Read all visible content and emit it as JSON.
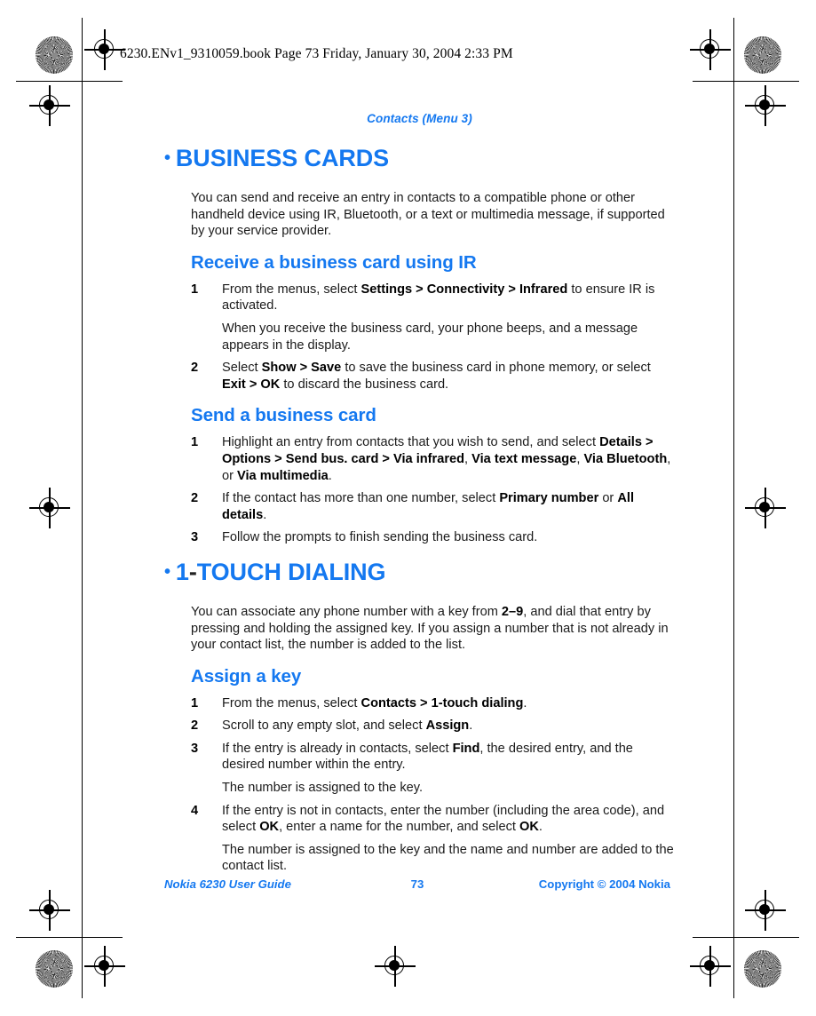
{
  "book_header": "6230.ENv1_9310059.book  Page 73  Friday, January 30, 2004  2:33 PM",
  "running_head": "Contacts (Menu 3)",
  "colors": {
    "accent_blue": "#1478f0",
    "body_text": "#1a1a1a",
    "page_background": "#ffffff"
  },
  "sections": [
    {
      "heading_bullet": "•",
      "heading_pre": "",
      "heading": "BUSINESS CARDS",
      "intro": "You can send and receive an entry in contacts to a compatible phone or other handheld device using IR, Bluetooth, or a text or multimedia message, if supported by your service provider.",
      "subsections": [
        {
          "heading": "Receive a business card using IR",
          "steps": [
            {
              "num": "1",
              "html": "From the menus, select <b>Settings &gt; Connectivity &gt; Infrared</b> to ensure IR is activated.",
              "follow": "When you receive the business card, your phone beeps, and a message appears in the display."
            },
            {
              "num": "2",
              "html": "Select <b>Show &gt; Save</b> to save the business card in phone memory, or select <b>Exit &gt; OK</b> to discard the business card.",
              "follow": ""
            }
          ]
        },
        {
          "heading": "Send a business card",
          "steps": [
            {
              "num": "1",
              "html": "Highlight an entry from contacts that you wish to send, and select <b>Details &gt; Options &gt; Send bus. card &gt; Via infrared</b>, <b>Via text message</b>, <b>Via Bluetooth</b>, or <b>Via multimedia</b>.",
              "follow": ""
            },
            {
              "num": "2",
              "html": "If the contact has more than one number, select <b>Primary number</b> or <b>All details</b>.",
              "follow": ""
            },
            {
              "num": "3",
              "html": "Follow the prompts to finish sending the business card.",
              "follow": ""
            }
          ]
        }
      ]
    },
    {
      "heading_bullet": "•",
      "heading_pre": "1",
      "heading_dash": "-",
      "heading": "TOUCH DIALING",
      "intro": "You can associate any phone number with a key from <b>2–9</b>, and dial that entry by pressing and holding the assigned key. If you assign a number that is not already in your contact list, the number is added to the list.",
      "subsections": [
        {
          "heading": "Assign a key",
          "steps": [
            {
              "num": "1",
              "html": "From the menus, select <b>Contacts &gt; 1-touch dialing</b>.",
              "follow": ""
            },
            {
              "num": "2",
              "html": "Scroll to any empty slot, and select <b>Assign</b>.",
              "follow": ""
            },
            {
              "num": "3",
              "html": "If the entry is already in contacts, select <b>Find</b>, the desired entry, and the desired number within the entry.",
              "follow": "The number is assigned to the key."
            },
            {
              "num": "4",
              "html": "If the entry is not in contacts, enter the number (including the area code), and select <b>OK</b>, enter a name for the number, and select <b>OK</b>.",
              "follow": "The number is assigned to the key and the name and number are added to the contact list."
            }
          ]
        }
      ]
    }
  ],
  "footer": {
    "left": "Nokia 6230 User Guide",
    "page_number": "73",
    "right": "Copyright © 2004 Nokia"
  }
}
